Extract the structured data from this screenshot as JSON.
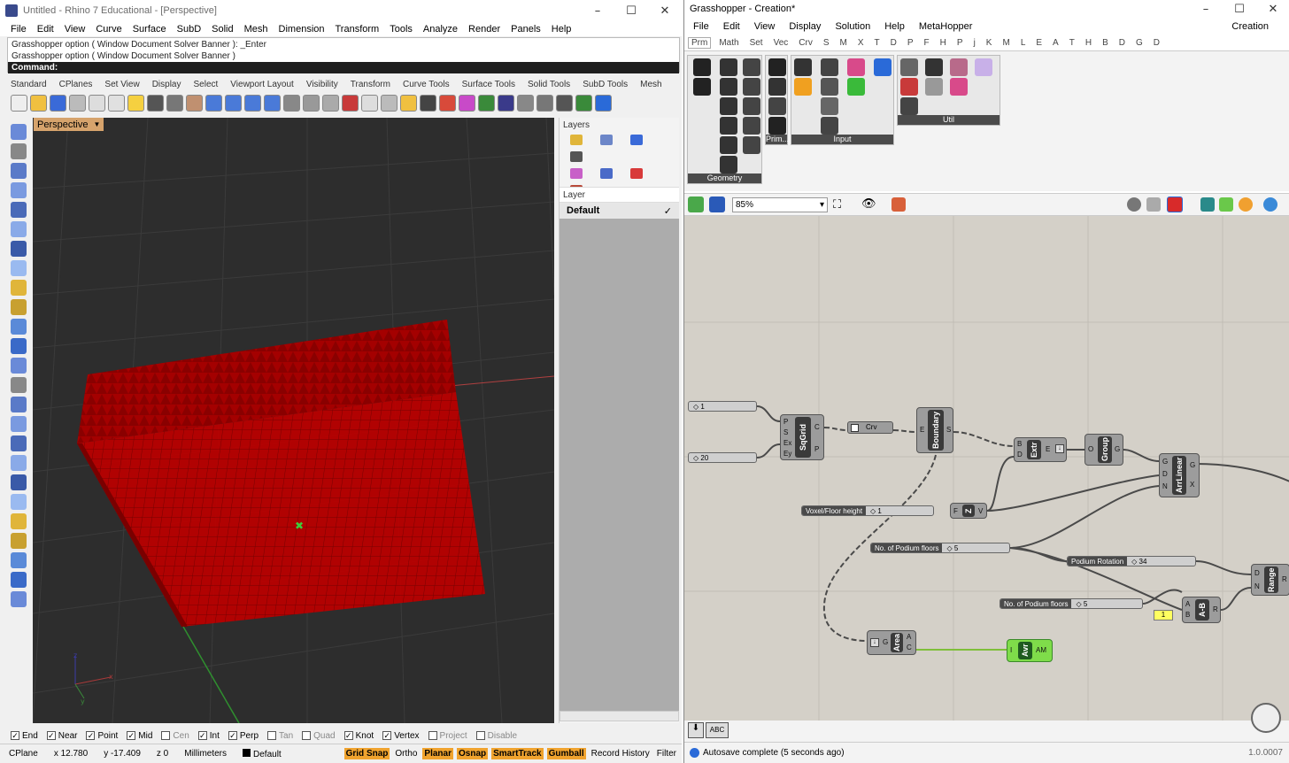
{
  "rhino": {
    "title": "Untitled - Rhino 7 Educational - [Perspective]",
    "menu": [
      "File",
      "Edit",
      "View",
      "Curve",
      "Surface",
      "SubD",
      "Solid",
      "Mesh",
      "Dimension",
      "Transform",
      "Tools",
      "Analyze",
      "Render",
      "Panels",
      "Help"
    ],
    "command_history": [
      "Grasshopper option ( Window  Document  Solver  Banner ): _Enter",
      "Grasshopper option ( Window  Document  Solver  Banner )"
    ],
    "command_prompt": "Command:",
    "toolbar_tabs": [
      "Standard",
      "CPlanes",
      "Set View",
      "Display",
      "Select",
      "Viewport Layout",
      "Visibility",
      "Transform",
      "Curve Tools",
      "Surface Tools",
      "Solid Tools",
      "SubD Tools",
      "Mesh"
    ],
    "viewport_label": "Perspective",
    "layers": {
      "title": "Layers",
      "column_header": "Layer",
      "rows": [
        {
          "name": "Default",
          "current": "✓"
        }
      ]
    },
    "osnaps": [
      {
        "label": "End",
        "checked": true
      },
      {
        "label": "Near",
        "checked": true
      },
      {
        "label": "Point",
        "checked": true
      },
      {
        "label": "Mid",
        "checked": true
      },
      {
        "label": "Cen",
        "checked": false
      },
      {
        "label": "Int",
        "checked": true
      },
      {
        "label": "Perp",
        "checked": true
      },
      {
        "label": "Tan",
        "checked": false
      },
      {
        "label": "Quad",
        "checked": false
      },
      {
        "label": "Knot",
        "checked": true
      },
      {
        "label": "Vertex",
        "checked": true
      },
      {
        "label": "Project",
        "checked": false
      },
      {
        "label": "Disable",
        "checked": false
      }
    ],
    "status": {
      "cplane": "CPlane",
      "x": "x 12.780",
      "y": "y -17.409",
      "z": "z 0",
      "units": "Millimeters",
      "layer": "Default",
      "toggles": [
        {
          "label": "Grid Snap",
          "on": true
        },
        {
          "label": "Ortho",
          "on": false
        },
        {
          "label": "Planar",
          "on": true
        },
        {
          "label": "Osnap",
          "on": true
        },
        {
          "label": "SmartTrack",
          "on": true
        },
        {
          "label": "Gumball",
          "on": true
        },
        {
          "label": "Record History",
          "on": false
        },
        {
          "label": "Filter",
          "on": false
        }
      ]
    },
    "colors": {
      "box": "#c00000",
      "viewport_bg": "#2d2d2d",
      "label_bg": "#d6a36c",
      "toggle_on": "#f0a32e"
    }
  },
  "gh": {
    "title": "Grasshopper - Creation*",
    "menu": [
      "File",
      "Edit",
      "View",
      "Display",
      "Solution",
      "Help",
      "MetaHopper"
    ],
    "doc_name": "Creation",
    "tabs": [
      "Prm",
      "Math",
      "Set",
      "Vec",
      "Crv",
      "S",
      "M",
      "X",
      "T",
      "D",
      "P",
      "F",
      "H",
      "P",
      "j",
      "K",
      "M",
      "L",
      "E",
      "A",
      "T",
      "H",
      "B",
      "D",
      "G",
      "D"
    ],
    "groups": [
      "Geometry",
      "Prim...",
      "Input",
      "Util"
    ],
    "zoom": "85%",
    "nodes": {
      "sqgrid": {
        "name": "SqGrid",
        "inputs": [
          "P",
          "S",
          "Ex",
          "Ey"
        ],
        "outputs": [
          "C",
          "P"
        ]
      },
      "crv": {
        "name": "Crv"
      },
      "boundary": {
        "name": "Boundary",
        "inputs": [
          "E"
        ],
        "outputs": [
          "S"
        ]
      },
      "extr": {
        "name": "Extr",
        "inputs": [
          "B",
          "D"
        ],
        "outputs": [
          "E"
        ]
      },
      "group": {
        "name": "Group",
        "inputs": [
          "O"
        ],
        "outputs": [
          "G"
        ]
      },
      "arrlinear": {
        "name": "ArrLinear",
        "inputs": [
          "G",
          "D",
          "N"
        ],
        "outputs": [
          "G",
          "X"
        ]
      },
      "unitz": {
        "name": "Z",
        "inputs": [
          "F"
        ],
        "outputs": [
          "V"
        ]
      },
      "range": {
        "name": "Range",
        "inputs": [
          "D",
          "N"
        ],
        "outputs": [
          "R"
        ]
      },
      "amb": {
        "name": "A-B",
        "inputs": [
          "A",
          "B"
        ],
        "outputs": [
          "R"
        ]
      },
      "area": {
        "name": "Area",
        "inputs": [
          "G"
        ],
        "outputs": [
          "A",
          "C"
        ]
      },
      "avr": {
        "name": "Avr",
        "inputs": [
          "I"
        ],
        "outputs": [
          "AM"
        ]
      }
    },
    "sliders": {
      "s1": {
        "label": "",
        "value": "◇ 1"
      },
      "s20": {
        "label": "",
        "value": "◇ 20"
      },
      "floor_height": {
        "label": "Voxel/Floor height",
        "value": "◇ 1"
      },
      "podium_floors": {
        "label": "No. of Podium floors",
        "value": "◇ 5"
      },
      "podium_rotation": {
        "label": "Podium Rotation",
        "value": "◇ 34"
      },
      "podium_floors2": {
        "label": "No. of Podium floors",
        "value": "◇ 5"
      }
    },
    "panel_one": "1",
    "status": "Autosave complete (5 seconds ago)",
    "version": "1.0.0007",
    "colors": {
      "canvas": "#d4d0c8",
      "node": "#9c9c9c",
      "node_core": "#3a3a3a",
      "avr": "#7fdc4a",
      "wire": "#4a4a4a"
    }
  }
}
